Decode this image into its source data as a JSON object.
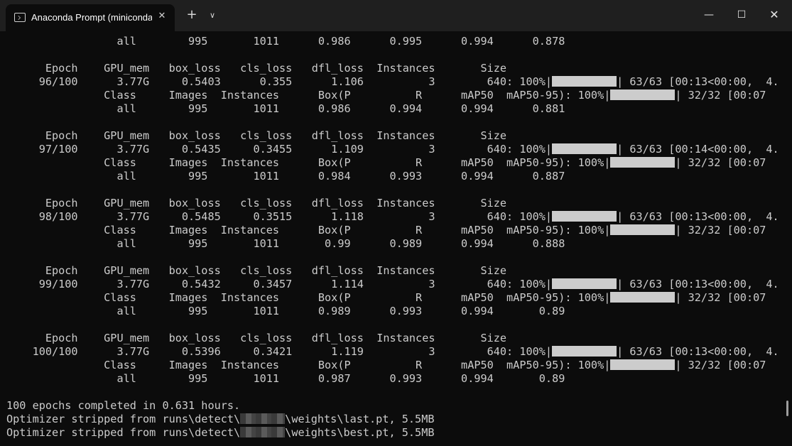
{
  "window": {
    "tab_title": "Anaconda Prompt (miniconda",
    "tab_close_glyph": "✕",
    "new_tab_glyph": "+",
    "dropdown_glyph": "∨",
    "minimize_glyph": "—",
    "maximize_glyph": "☐",
    "close_glyph": "✕",
    "icons": [
      "terminal-icon",
      "close-icon",
      "plus-icon",
      "chevron-down-icon",
      "minimize-icon",
      "maximize-icon",
      "close-icon"
    ]
  },
  "terminal": {
    "lines": [
      "                 all        995       1011      0.986      0.995      0.994      0.878",
      "",
      "      Epoch    GPU_mem   box_loss   cls_loss   dfl_loss  Instances       Size",
      "     96/100      3.77G     0.5403      0.355      1.106          3        640: 100%|",
      "               Class     Images  Instances      Box(P          R      mAP50  mAP50-95): 100%|",
      "                 all        995       1011      0.986      0.994      0.994      0.881",
      "",
      "      Epoch    GPU_mem   box_loss   cls_loss   dfl_loss  Instances       Size",
      "     97/100      3.77G     0.5435     0.3455      1.109          3        640: 100%|",
      "               Class     Images  Instances      Box(P          R      mAP50  mAP50-95): 100%|",
      "                 all        995       1011      0.984      0.993      0.994      0.887",
      "",
      "      Epoch    GPU_mem   box_loss   cls_loss   dfl_loss  Instances       Size",
      "     98/100      3.77G     0.5485     0.3515      1.118          3        640: 100%|",
      "               Class     Images  Instances      Box(P          R      mAP50  mAP50-95): 100%|",
      "                 all        995       1011       0.99      0.989      0.994      0.888",
      "",
      "      Epoch    GPU_mem   box_loss   cls_loss   dfl_loss  Instances       Size",
      "     99/100      3.77G     0.5432     0.3457      1.114          3        640: 100%|",
      "               Class     Images  Instances      Box(P          R      mAP50  mAP50-95): 100%|",
      "                 all        995       1011      0.989      0.993      0.994       0.89",
      "",
      "      Epoch    GPU_mem   box_loss   cls_loss   dfl_loss  Instances       Size",
      "    100/100      3.77G     0.5396     0.3421      1.119          3        640: 100%|",
      "               Class     Images  Instances      Box(P          R      mAP50  mAP50-95): 100%|",
      "                 all        995       1011      0.987      0.993      0.994       0.89",
      "",
      "100 epochs completed in 0.631 hours.",
      "Optimizer stripped from runs\\detect\\",
      "Optimizer stripped from runs\\detect\\"
    ],
    "line_tails": {
      "3": "| 63/63 [00:13<00:00,  4.",
      "4": "| 32/32 [00:07",
      "8": "| 63/63 [00:14<00:00,  4.",
      "9": "| 32/32 [00:07",
      "13": "| 63/63 [00:13<00:00,  4.",
      "14": "| 32/32 [00:07",
      "18": "| 63/63 [00:13<00:00,  4.",
      "19": "| 32/32 [00:07",
      "23": "| 63/63 [00:13<00:00,  4.",
      "24": "| 32/32 [00:07",
      "28": "\\weights\\last.pt, 5.5MB",
      "29": "\\weights\\best.pt, 5.5MB"
    },
    "progress_bar_lines": [
      3,
      4,
      8,
      9,
      13,
      14,
      18,
      19,
      23,
      24
    ],
    "progress_bar_fraction": 1.0,
    "redacted_lines": [
      28,
      29
    ]
  }
}
